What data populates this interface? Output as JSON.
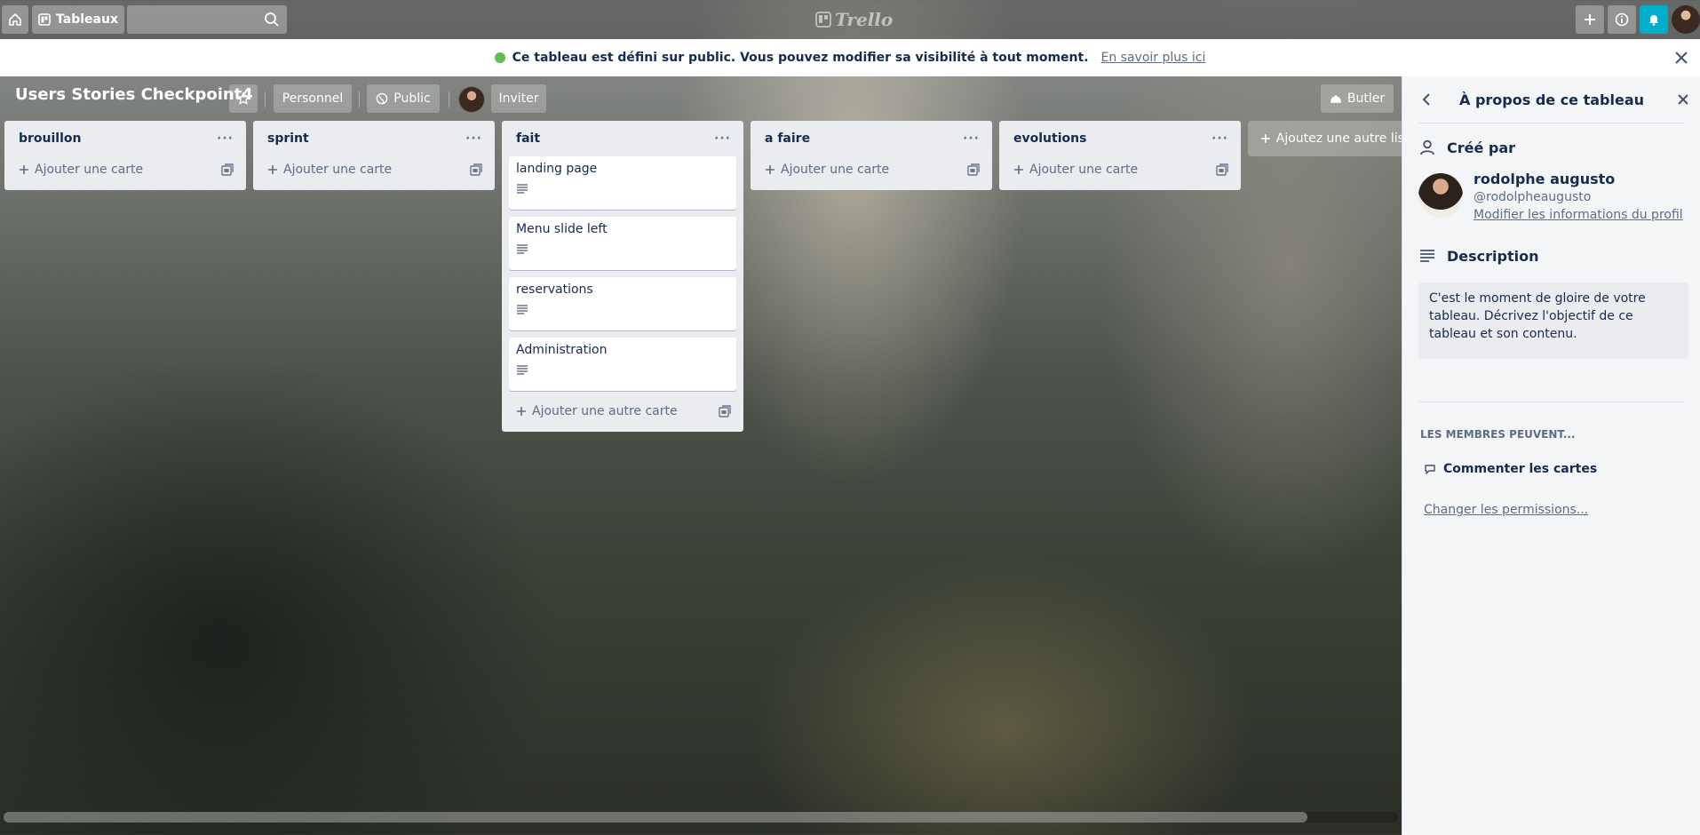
{
  "header": {
    "boards_label": "Tableaux",
    "search_placeholder": "",
    "logo_text": "Trello"
  },
  "banner": {
    "message": "Ce tableau est défini sur public. Vous pouvez modifier sa visibilité à tout moment.",
    "link": "En savoir plus ici"
  },
  "board": {
    "title": "Users Stories Checkpoint4",
    "personal_label": "Personnel",
    "public_label": "Public",
    "invite_label": "Inviter",
    "butler_label": "Butler",
    "add_list_label": "Ajoutez une autre liste"
  },
  "lists": [
    {
      "title": "brouillon",
      "add_label": "Ajouter une carte",
      "cards": []
    },
    {
      "title": "sprint",
      "add_label": "Ajouter une carte",
      "cards": []
    },
    {
      "title": "fait",
      "add_label": "Ajouter une autre carte",
      "cards": [
        "landing page",
        "Menu slide left",
        "reservations",
        "Administration"
      ]
    },
    {
      "title": "a faire",
      "add_label": "Ajouter une carte",
      "cards": []
    },
    {
      "title": "evolutions",
      "add_label": "Ajouter une carte",
      "cards": []
    }
  ],
  "panel": {
    "title": "À propos de ce tableau",
    "created_by_label": "Créé par",
    "creator_name": "rodolphe augusto",
    "creator_username": "@rodolpheaugusto",
    "edit_profile_link": "Modifier les informations du profil",
    "description_label": "Description",
    "description_text": "C'est le moment de gloire de votre tableau. Décrivez l'objectif de ce tableau et son contenu.",
    "members_can_label": "LES MEMBRES PEUVENT...",
    "permission_item": "Commenter les cartes",
    "change_permissions_link": "Changer les permissions..."
  },
  "colors": {
    "notification_button": "#00aecc",
    "public_indicator": "#61bd4f",
    "list_background": "#ebecf0",
    "panel_background": "#f4f5f7"
  },
  "icons": {
    "home": "home-icon",
    "boards": "board-icon",
    "search": "search-icon",
    "add": "plus-icon",
    "info": "info-icon",
    "notifications": "bell-icon",
    "star": "star-icon",
    "public": "globe-icon",
    "butler": "butler-icon",
    "card_description": "description-icon",
    "template": "template-icon",
    "comment": "comment-icon",
    "person": "person-icon"
  }
}
